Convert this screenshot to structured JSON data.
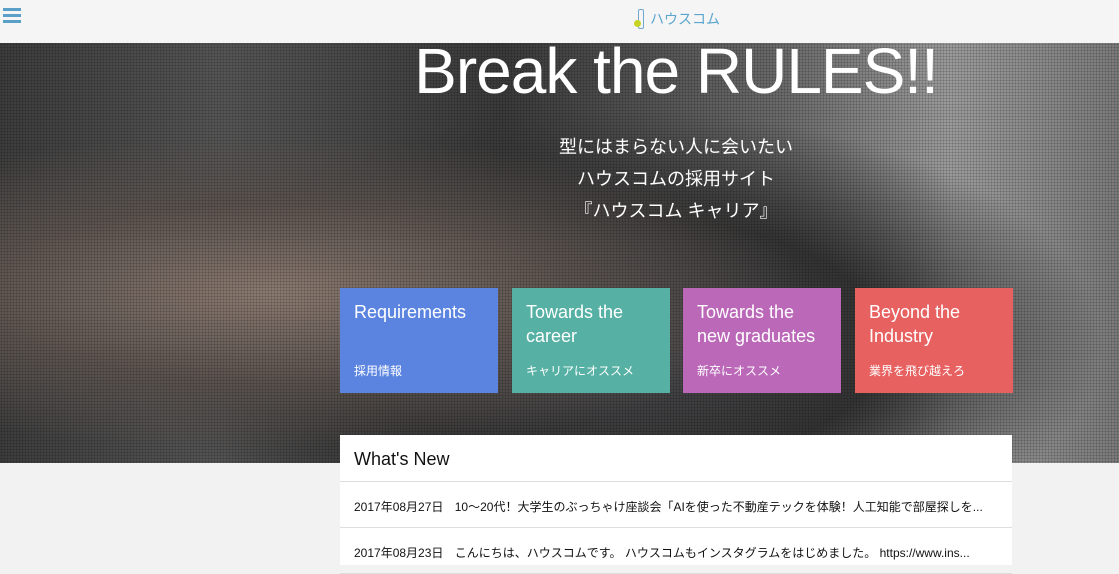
{
  "header": {
    "logo_text": "ハウスコム"
  },
  "hero": {
    "title": "Break the RULES!!",
    "subtitle": [
      "型にはまらない人に会いたい",
      "ハウスコムの採用サイト",
      "『ハウスコム キャリア』"
    ]
  },
  "cards": [
    {
      "title": "Requirements",
      "sub": "採用情報",
      "color": "#5b84e0"
    },
    {
      "title": "Towards the career",
      "sub": "キャリアにオススメ",
      "color": "#56b0a3"
    },
    {
      "title": "Towards the new graduates",
      "sub": "新卒にオススメ",
      "color": "#bb68b9"
    },
    {
      "title": "Beyond the Industry",
      "sub": "業界を飛び越えろ",
      "color": "#e86161"
    }
  ],
  "news": {
    "heading": "What's New",
    "items": [
      {
        "date": "2017年08月27日",
        "text": "10～20代！大学生のぶっちゃけ座談会「AIを使った不動産テックを体験！人工知能で部屋探しを..."
      },
      {
        "date": "2017年08月23日",
        "text": "こんにちは、ハウスコムです。 ハウスコムもインスタグラムをはじめました。 https://www.ins..."
      }
    ]
  }
}
